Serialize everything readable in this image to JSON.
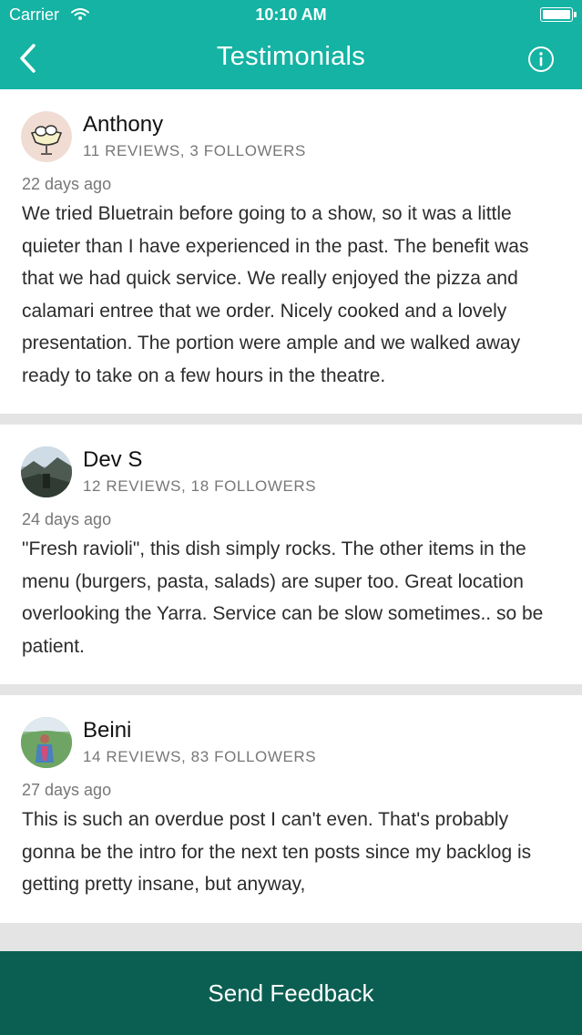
{
  "status_bar": {
    "carrier": "Carrier",
    "time": "10:10 AM"
  },
  "nav": {
    "title": "Testimonials",
    "back_icon": "chevron-left-icon",
    "info_icon": "info-icon"
  },
  "reviews": [
    {
      "name": "Anthony",
      "stats": "11 REVIEWS, 3 FOLLOWERS",
      "age": "22 days ago",
      "text": "We tried Bluetrain before going to a show, so it was a little quieter than I have experienced in the past. The benefit was that we had quick service. We really enjoyed the pizza and calamari entree that we order. Nicely cooked and a lovely presentation. The portion were ample and we walked away ready to take on a few hours in the theatre."
    },
    {
      "name": "Dev S",
      "stats": "12 REVIEWS, 18 FOLLOWERS",
      "age": "24 days ago",
      "text": "\"Fresh ravioli\", this dish simply rocks.  The other items in the menu (burgers, pasta, salads) are super too. Great location overlooking the Yarra. Service can be slow sometimes.. so be patient."
    },
    {
      "name": "Beini",
      "stats": "14 REVIEWS, 83 FOLLOWERS",
      "age": "27 days ago",
      "text": "This is such an overdue post I can't even. That's probably gonna be the intro for the next ten posts since my backlog is getting pretty insane, but anyway,"
    }
  ],
  "footer": {
    "label": "Send Feedback"
  },
  "colors": {
    "header": "#14b3a3",
    "footer": "#0b5f52",
    "separator": "#e4e4e4"
  }
}
